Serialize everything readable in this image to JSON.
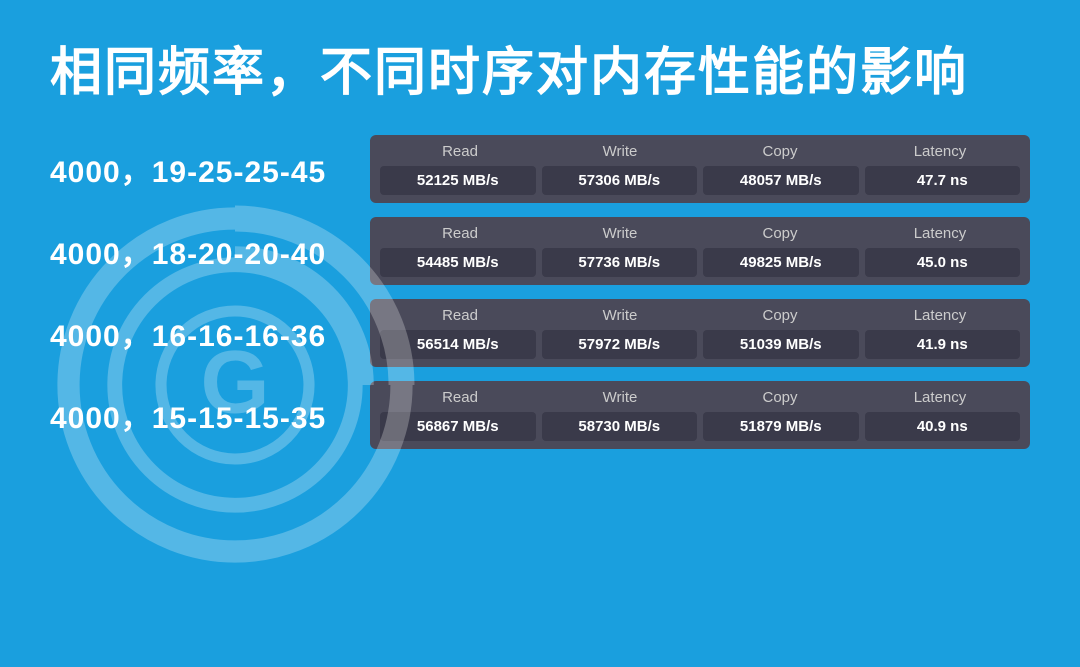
{
  "title": "相同频率，不同时序对内存性能的影响",
  "rows": [
    {
      "label": "4000，19-25-25-45",
      "read": "52125 MB/s",
      "write": "57306 MB/s",
      "copy": "48057 MB/s",
      "latency": "47.7 ns"
    },
    {
      "label": "4000，18-20-20-40",
      "read": "54485 MB/s",
      "write": "57736 MB/s",
      "copy": "49825 MB/s",
      "latency": "45.0 ns"
    },
    {
      "label": "4000，16-16-16-36",
      "read": "56514 MB/s",
      "write": "57972 MB/s",
      "copy": "51039 MB/s",
      "latency": "41.9 ns"
    },
    {
      "label": "4000，15-15-15-35",
      "read": "56867 MB/s",
      "write": "58730 MB/s",
      "copy": "51879 MB/s",
      "latency": "40.9 ns"
    }
  ],
  "headers": {
    "read": "Read",
    "write": "Write",
    "copy": "Copy",
    "latency": "Latency"
  }
}
